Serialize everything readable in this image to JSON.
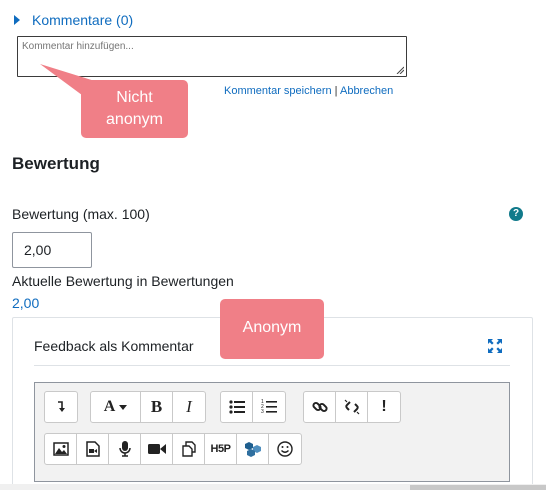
{
  "comments": {
    "toggle_label": "Kommentare (0)",
    "placeholder": "Kommentar hinzufügen...",
    "save_label": "Kommentar speichern",
    "separator": "|",
    "cancel_label": "Abbrechen"
  },
  "callouts": {
    "not_anonymous": "Nicht\nanonym",
    "anonymous": "Anonym",
    "color": "#f07f87"
  },
  "grading": {
    "heading": "Bewertung",
    "grade_label": "Bewertung (max. 100)",
    "grade_value": "2,00",
    "help_icon": "?",
    "current_label": "Aktuelle Bewertung in Bewertungen",
    "current_value": "2,00"
  },
  "feedback": {
    "title": "Feedback als Kommentar",
    "toolbar_row1": [
      [
        "collapse-icon"
      ],
      [
        "font-style-icon",
        "bold-icon",
        "italic-icon"
      ],
      [
        "bullet-list-icon",
        "numbered-list-icon"
      ],
      [
        "link-icon",
        "unlink-icon",
        "accessibility-check-icon"
      ]
    ],
    "toolbar_row2": [
      "image-icon",
      "media-icon",
      "record-audio-icon",
      "record-video-icon",
      "manage-files-icon",
      "h5p-icon",
      "content-bank-icon",
      "emoji-icon"
    ],
    "glyphs": {
      "bold": "B",
      "italic": "I",
      "font": "A",
      "h5p": "H5P",
      "excl": "!"
    }
  },
  "colors": {
    "link": "#0f6cbf",
    "help": "#117a8b",
    "callout": "#f07f87"
  }
}
